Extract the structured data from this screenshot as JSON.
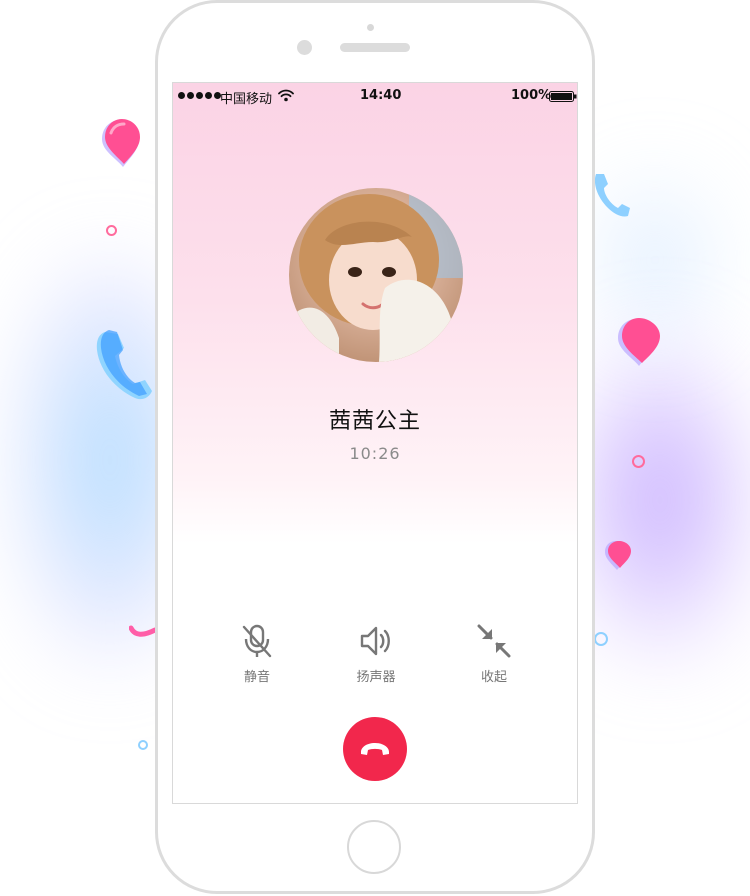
{
  "status_bar": {
    "carrier": "中国移动",
    "time": "14:40",
    "battery": "100%"
  },
  "call": {
    "caller_name": "茜茜公主",
    "duration": "10:26"
  },
  "controls": {
    "mute_label": "静音",
    "speaker_label": "扬声器",
    "collapse_label": "收起"
  },
  "icons": {
    "mute": "mic-off-icon",
    "speaker": "speaker-icon",
    "collapse": "collapse-arrows-icon",
    "hangup": "phone-hangup-icon"
  },
  "colors": {
    "hangup": "#f2274c",
    "screen_top": "#fbd3e5",
    "accent_pink": "#ff5e9a",
    "accent_blue": "#62b6ff",
    "accent_purple": "#a98bff"
  }
}
